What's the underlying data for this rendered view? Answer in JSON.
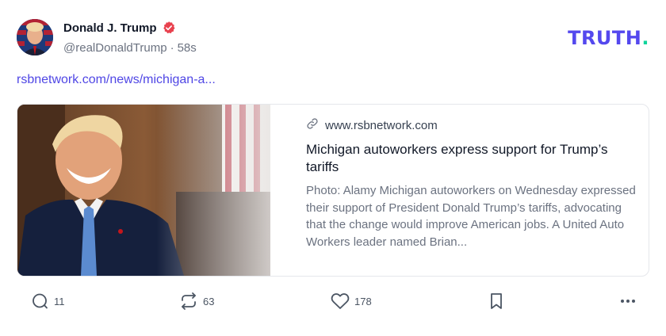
{
  "author": {
    "display_name": "Donald J. Trump",
    "handle": "@realDonaldTrump",
    "separator": "·",
    "time_ago": "58s",
    "verified_icon": "verified-badge-icon"
  },
  "brand": {
    "logo_text": "TRUTH",
    "logo_dot": ".",
    "color": "#5448ee",
    "dot_color": "#0fd49b"
  },
  "post": {
    "link_text": "rsbnetwork.com/news/michigan-a..."
  },
  "card": {
    "domain": "www.rsbnetwork.com",
    "title": "Michigan autoworkers express support for Trump’s tariffs",
    "description": "Photo: Alamy Michigan autoworkers on Wednesday expressed their support of President Donald Trump’s tariffs, advocating that the change would improve American jobs. A United Auto Workers leader named Brian...",
    "link_icon": "link-icon"
  },
  "actions": {
    "replies": "11",
    "retruths": "63",
    "likes": "178"
  },
  "colors": {
    "accent": "#4f46e5",
    "muted": "#6b7280",
    "verified": "#e8414e"
  }
}
